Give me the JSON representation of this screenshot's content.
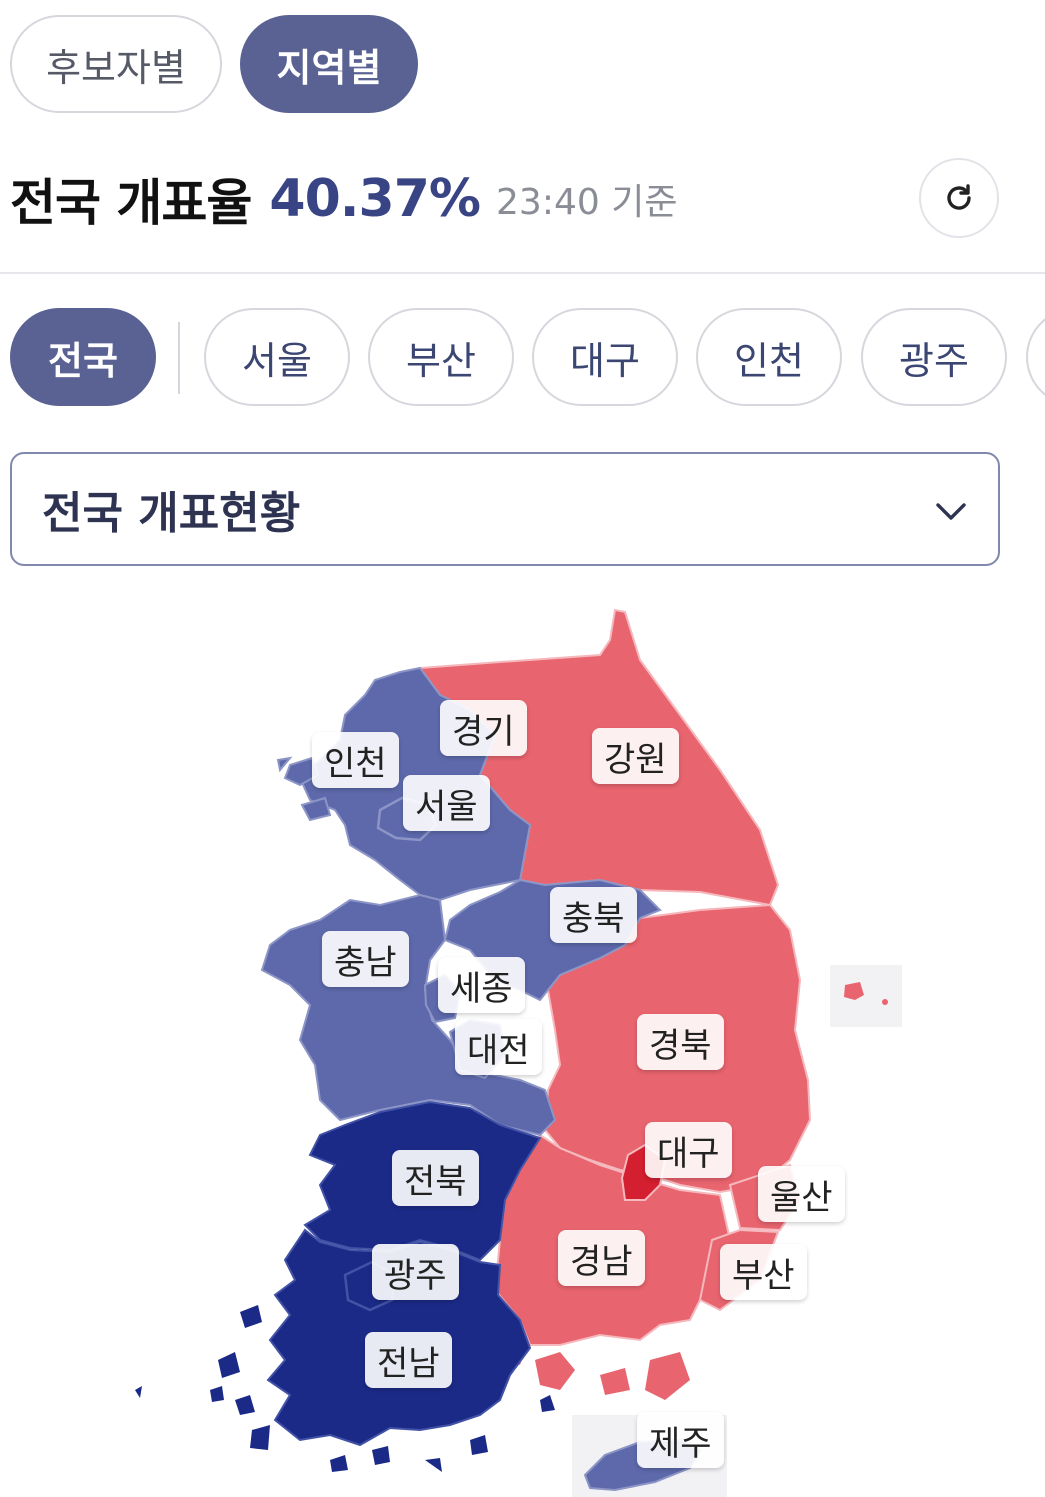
{
  "tabs": [
    {
      "label": "후보자별",
      "active": false
    },
    {
      "label": "지역별",
      "active": true
    }
  ],
  "summary": {
    "title": "전국 개표율",
    "rate": "40.37%",
    "time": "23:40 기준"
  },
  "regions": [
    "전국",
    "서울",
    "부산",
    "대구",
    "인천",
    "광주"
  ],
  "selected_region": "전국",
  "dropdown": {
    "label": "전국 개표현황"
  },
  "map": {
    "colors": {
      "blue_light": "#5d69ab",
      "blue_dark": "#1b2a87",
      "red_light": "#e8646e",
      "red_dark": "#d31f2f"
    },
    "labels": {
      "gyeonggi": "경기",
      "incheon": "인천",
      "seoul": "서울",
      "gangwon": "강원",
      "chungbuk": "충북",
      "chungnam": "충남",
      "sejong": "세종",
      "daejeon": "대전",
      "gyeongbuk": "경북",
      "jeonbuk": "전북",
      "daegu": "대구",
      "ulsan": "울산",
      "gwangju": "광주",
      "gyeongnam": "경남",
      "busan": "부산",
      "jeonnam": "전남",
      "jeju": "제주"
    }
  }
}
